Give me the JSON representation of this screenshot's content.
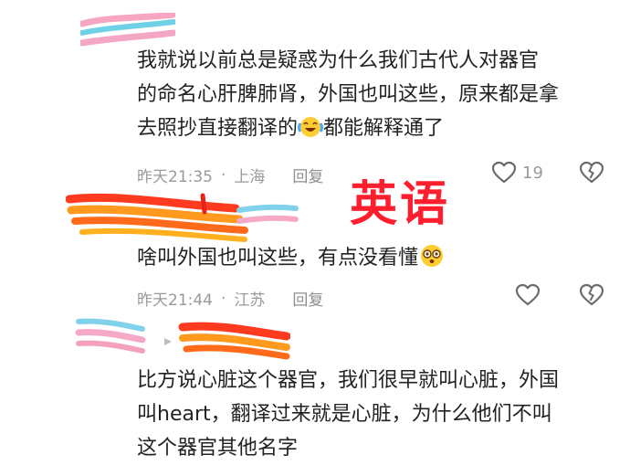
{
  "comments": [
    {
      "lines": [
        "我就说以前总是疑惑为什么我们古代人对器官",
        "的命名心肝脾肺肾，外国也叫这些，原来都是拿",
        "去照抄直接翻译的",
        "都能解释通了"
      ],
      "emoji": "laughing-crying-emoji",
      "time": "昨天21:35",
      "location": "上海",
      "reply_label": "回复",
      "like_count": "19"
    },
    {
      "text": "啥叫外国也叫这些，有点没看懂",
      "emoji": "dizzy-face-emoji",
      "time": "昨天21:44",
      "location": "江苏",
      "reply_label": "回复"
    },
    {
      "lines": [
        "比方说心脏这个器官，我们很早就叫心脏，外国",
        "叫heart，翻译过来就是心脏，为什么他们不叫",
        "这个器官其他名字"
      ]
    }
  ],
  "overlay_text": "英语",
  "icons": {
    "like": "heart-outline-icon",
    "dislike": "broken-heart-icon"
  },
  "colors": {
    "overlay": "#ff1e2d",
    "meta_gray": "#9a9a9a"
  }
}
